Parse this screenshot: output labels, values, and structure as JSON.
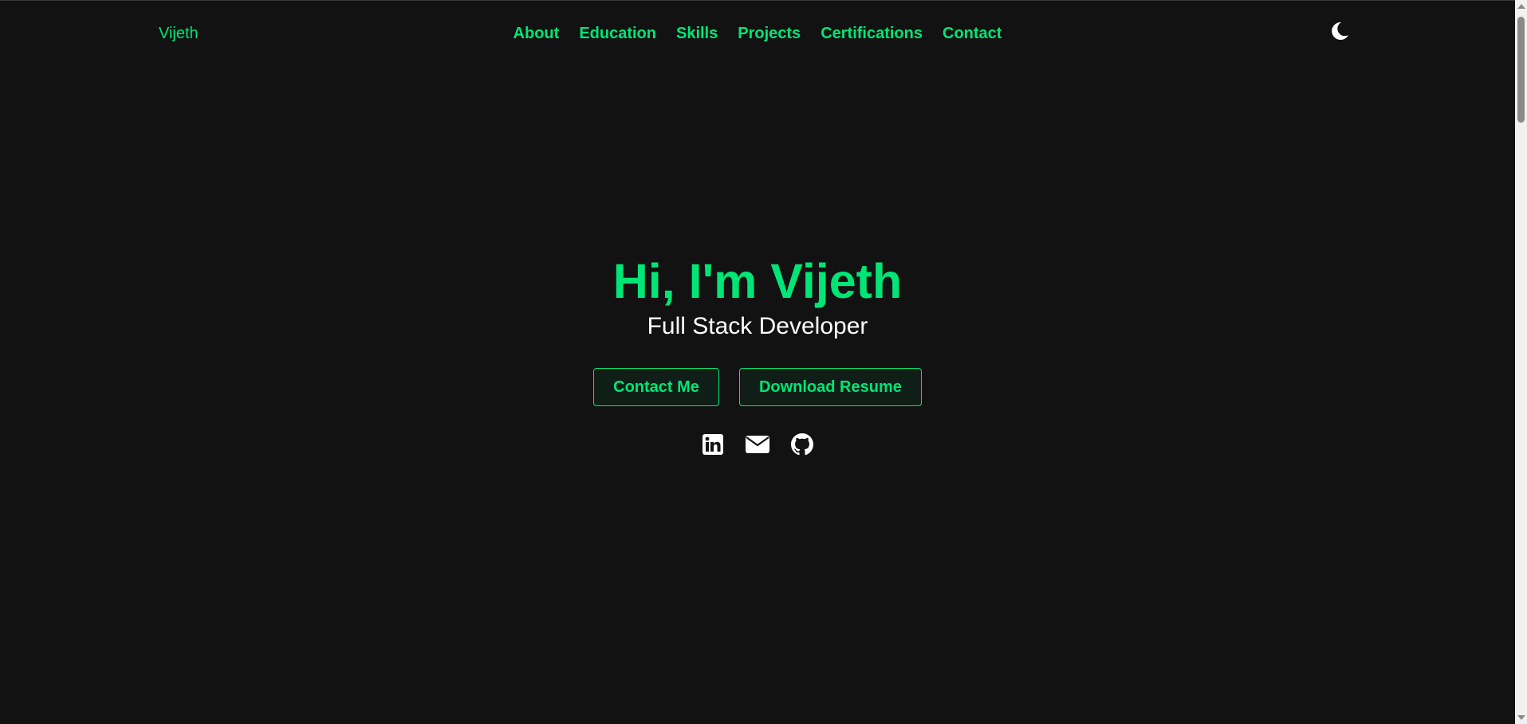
{
  "header": {
    "brand": "Vijeth",
    "nav": [
      "About",
      "Education",
      "Skills",
      "Projects",
      "Certifications",
      "Contact"
    ],
    "theme_icon": "moon-icon"
  },
  "hero": {
    "title": "Hi, I'm Vijeth",
    "subtitle": "Full Stack Developer",
    "contact_button": "Contact Me",
    "resume_button": "Download Resume",
    "social_icons": [
      "linkedin-icon",
      "envelope-icon",
      "github-icon"
    ]
  },
  "colors": {
    "background": "#121212",
    "accent": "#00e676",
    "text": "#ffffff"
  }
}
